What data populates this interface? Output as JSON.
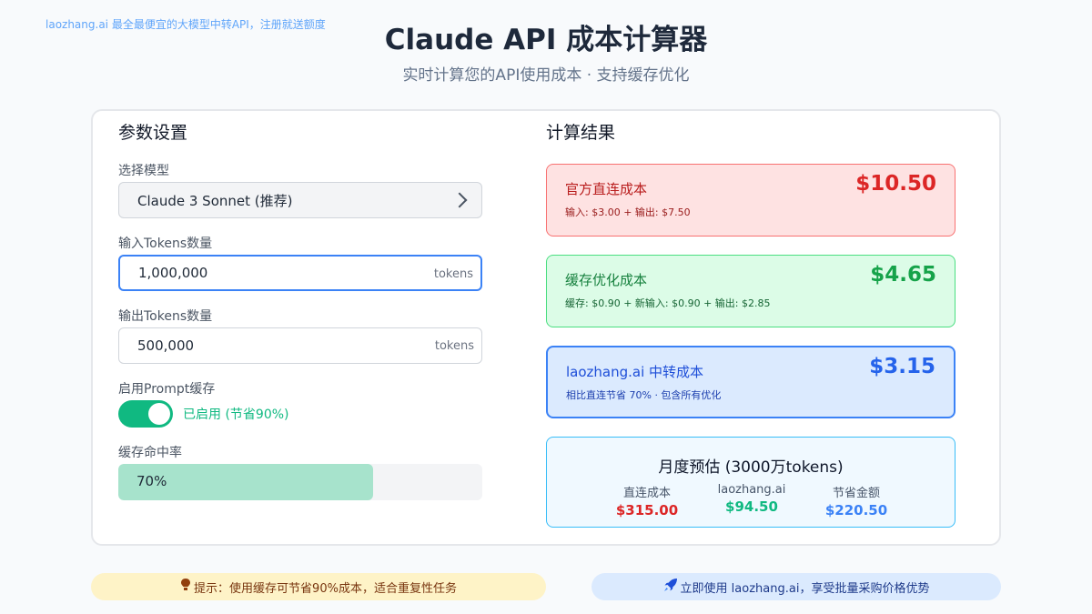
{
  "brand": "laozhang.ai 最全最便宜的大模型中转API，注册就送额度",
  "title": "Claude API 成本计算器",
  "subtitle": "实时计算您的API使用成本 · 支持缓存优化",
  "params": {
    "heading": "参数设置",
    "model_label": "选择模型",
    "model_value": "Claude 3 Sonnet (推荐)",
    "input_tokens_label": "输入Tokens数量",
    "input_tokens_value": "1,000,000",
    "output_tokens_label": "输出Tokens数量",
    "output_tokens_value": "500,000",
    "unit": "tokens",
    "cache_label": "启用Prompt缓存",
    "cache_enabled": true,
    "cache_status": "已启用 (节省90%)",
    "hit_rate_label": "缓存命中率",
    "hit_rate_text": "70%",
    "hit_rate": 0.7
  },
  "results": {
    "heading": "计算结果",
    "official": {
      "title": "官方直连成本",
      "amount": "$10.50",
      "detail": "输入: $3.00 + 输出: $7.50"
    },
    "cache": {
      "title": "缓存优化成本",
      "amount": "$4.65",
      "detail": "缓存: $0.90 + 新输入: $0.90 + 输出: $2.85"
    },
    "relay": {
      "title": "laozhang.ai 中转成本",
      "amount": "$3.15",
      "detail": "相比直连节省 70% · 包含所有优化"
    },
    "monthly": {
      "title": "月度预估 (3000万tokens)",
      "direct_label": "直连成本",
      "direct_value": "$315.00",
      "relay_label": "laozhang.ai",
      "relay_value": "$94.50",
      "saving_label": "节省金额",
      "saving_value": "$220.50"
    }
  },
  "tips": {
    "hint": "提示：使用缓存可节省90%成本，适合重复性任务",
    "hint_icon": "lightbulb-icon",
    "cta": "立即使用 laozhang.ai，享受批量采购价格优势",
    "cta_icon": "rocket-icon"
  },
  "colors": {
    "accent_green": "#10b981",
    "accent_blue": "#3b82f6",
    "accent_red": "#dc2626"
  }
}
